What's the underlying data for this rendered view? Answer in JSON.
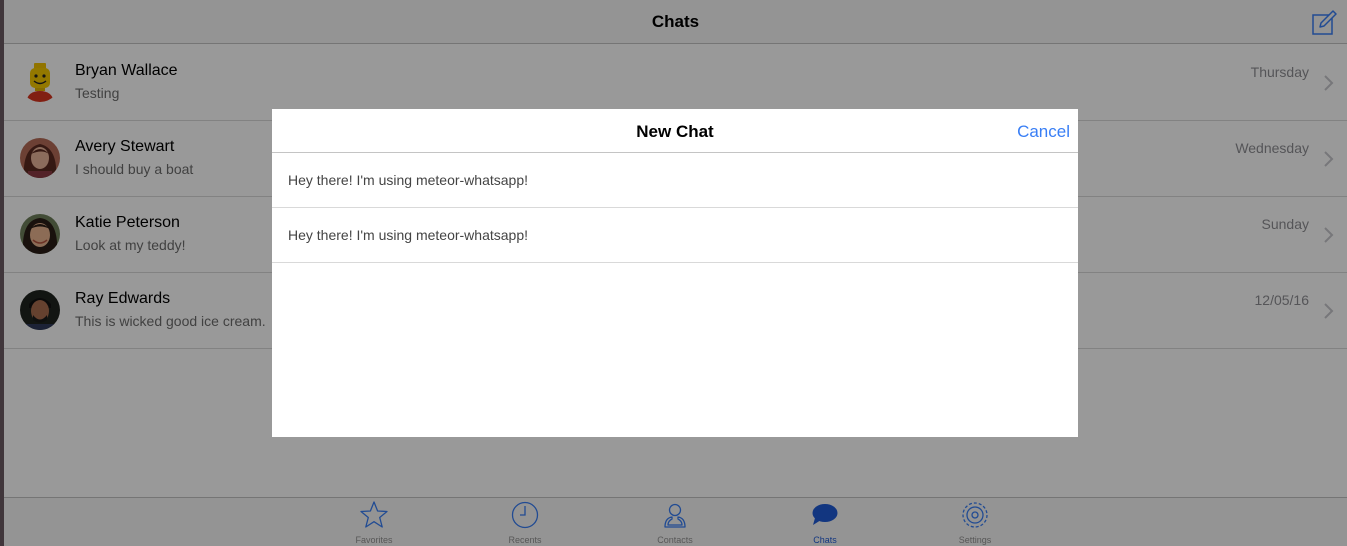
{
  "navbar": {
    "title": "Chats",
    "compose_icon": "compose-icon",
    "accent_color": "#387ef5"
  },
  "chats": [
    {
      "name": "Bryan Wallace",
      "message": "Testing",
      "time": "Thursday",
      "avatar": "lego-avatar"
    },
    {
      "name": "Avery Stewart",
      "message": "I should buy a boat",
      "time": "Wednesday",
      "avatar": "photo-avatar"
    },
    {
      "name": "Katie Peterson",
      "message": "Look at my teddy!",
      "time": "Sunday",
      "avatar": "photo-avatar"
    },
    {
      "name": "Ray Edwards",
      "message": "This is wicked good ice cream.",
      "time": "12/05/16",
      "avatar": "photo-avatar"
    }
  ],
  "tabs": [
    {
      "label": "Favorites",
      "icon": "star-icon",
      "active": false
    },
    {
      "label": "Recents",
      "icon": "clock-icon",
      "active": false
    },
    {
      "label": "Contacts",
      "icon": "person-icon",
      "active": false
    },
    {
      "label": "Chats",
      "icon": "chat-bubble-icon",
      "active": true
    },
    {
      "label": "Settings",
      "icon": "gear-icon",
      "active": false
    }
  ],
  "modal": {
    "title": "New Chat",
    "cancel_label": "Cancel",
    "items": [
      {
        "status": "Hey there! I'm using meteor-whatsapp!"
      },
      {
        "status": "Hey there! I'm using meteor-whatsapp!"
      }
    ]
  }
}
